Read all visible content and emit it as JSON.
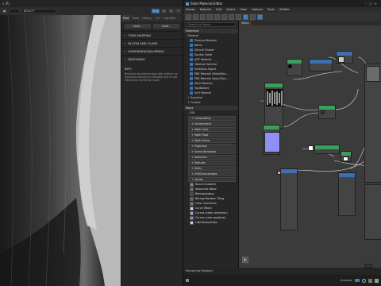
{
  "render_window": {
    "title": "s (R)",
    "toolbar": {
      "preset": "BEAUTY",
      "btn_stop": "Stop",
      "btn_a": "A",
      "btn_s": "S"
    },
    "tabs": [
      "Post",
      "Stats",
      "History",
      "LUT",
      "LightMix"
    ],
    "active_tab": "Post",
    "buttons": {
      "save": "Save...",
      "load": "Load..."
    },
    "sections": [
      "TONE MAPPING",
      "BLOOM AND GLARE",
      "SHARPENING/BLURRING",
      "DENOISING"
    ],
    "info_title": "INFO",
    "info_text": "Blending denoised image with original via denoising amount is available only to use interactive rendering mode"
  },
  "slate": {
    "title": "Slate Material Editor",
    "menu": [
      "Modes",
      "Material",
      "Edit",
      "Select",
      "View",
      "Options",
      "Tools",
      "Utilities"
    ],
    "view_tab": "View1",
    "search_placeholder": "Search by Name ...",
    "groups": {
      "materials": "Materials",
      "general": "General",
      "scanline": "Scanline",
      "corona": "Corona",
      "maps": "Maps",
      "osl": "OSL"
    },
    "material_items": [
      "Physical Material",
      "Blend",
      "DirectX Shader",
      "Double Sided",
      "glTF Material",
      "Material Switcher",
      "Multi/Sub-Object",
      "PBR Material (Metal/Rou...",
      "PBR Material (Spec/Glos...",
      "Shell Material",
      "Top/Bottom",
      "Xref Material"
    ],
    "osl_categories": [
      "Compositing",
      "Environment",
      "Math Color",
      "Math Float",
      "Math Vector",
      "Projection",
      "Scene Attributes",
      "Switchers",
      "Textures",
      "Utility",
      "UVW/Coordinates",
      "Values"
    ],
    "map_items": [
      "Round Gradient",
      "Advanced Wood",
      "BitmapLookup",
      "Bitmap Random Tiling",
      "Color Correction",
      "Curve (float)",
      "Curves (color correction)",
      "Curves (color gradient)",
      "Lift/Gamma/Gain"
    ],
    "status": "Rendering finished",
    "bottom_status": "Enabled:",
    "colors": {
      "accent": "#3e7fc1",
      "node_header_green": "#3a9e5c",
      "node_header_blue": "#3d6fb0",
      "canvas": "#3b3b3b"
    }
  }
}
